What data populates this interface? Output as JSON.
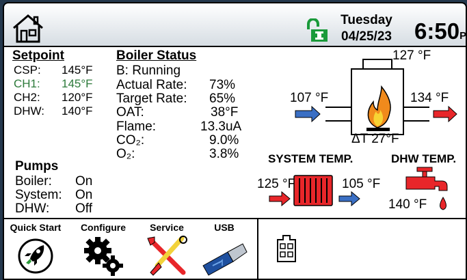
{
  "header": {
    "day": "Tuesday",
    "date": "04/25/23",
    "time": "6:50",
    "ampm": "PM",
    "icons": {
      "home": "home-icon",
      "lock": "unlocked-icon"
    },
    "colors": {
      "lock": "#1a9a3a"
    }
  },
  "setpoint": {
    "title": "Setpoint",
    "rows": [
      {
        "label": "CSP:",
        "value": "145°F"
      },
      {
        "label": "CH1:",
        "value": "145°F"
      },
      {
        "label": "CH2:",
        "value": "120°F"
      },
      {
        "label": "DHW:",
        "value": "140°F"
      }
    ]
  },
  "boiler_status": {
    "title": "Boiler Status",
    "state": "B: Running",
    "rows": [
      {
        "label": "Actual Rate:",
        "value": "73%"
      },
      {
        "label": "Target Rate:",
        "value": "65%"
      },
      {
        "label": "OAT:",
        "value": "38°F"
      },
      {
        "label": "Flame:",
        "value": "13.3uA"
      },
      {
        "label": "CO₂:",
        "value": "9.0%"
      },
      {
        "label": "O₂:",
        "value": "3.8%"
      }
    ]
  },
  "pumps": {
    "title": "Pumps",
    "rows": [
      {
        "label": "Boiler:",
        "value": "On"
      },
      {
        "label": "System:",
        "value": "On"
      },
      {
        "label": "DHW:",
        "value": "Off"
      }
    ]
  },
  "diagram": {
    "stack_temp": "127 °F",
    "inlet_temp": "107 °F",
    "outlet_temp": "134 °F",
    "delta_t": "ΔT 27°F",
    "system_title": "SYSTEM TEMP.",
    "system_in": "125 °F",
    "system_out": "105 °F",
    "dhw_title": "DHW TEMP.",
    "dhw_temp": "140 °F",
    "colors": {
      "hot": "#e8262a",
      "cold": "#3a6fc4",
      "flame": "#f08a1c"
    }
  },
  "menu": {
    "items": [
      {
        "label": "Quick Start",
        "icon": "rocket-icon"
      },
      {
        "label": "Configure",
        "icon": "gears-icon"
      },
      {
        "label": "Service",
        "icon": "tools-icon"
      },
      {
        "label": "USB",
        "icon": "usb-drive-icon"
      }
    ],
    "building_icon": "building-icon"
  }
}
